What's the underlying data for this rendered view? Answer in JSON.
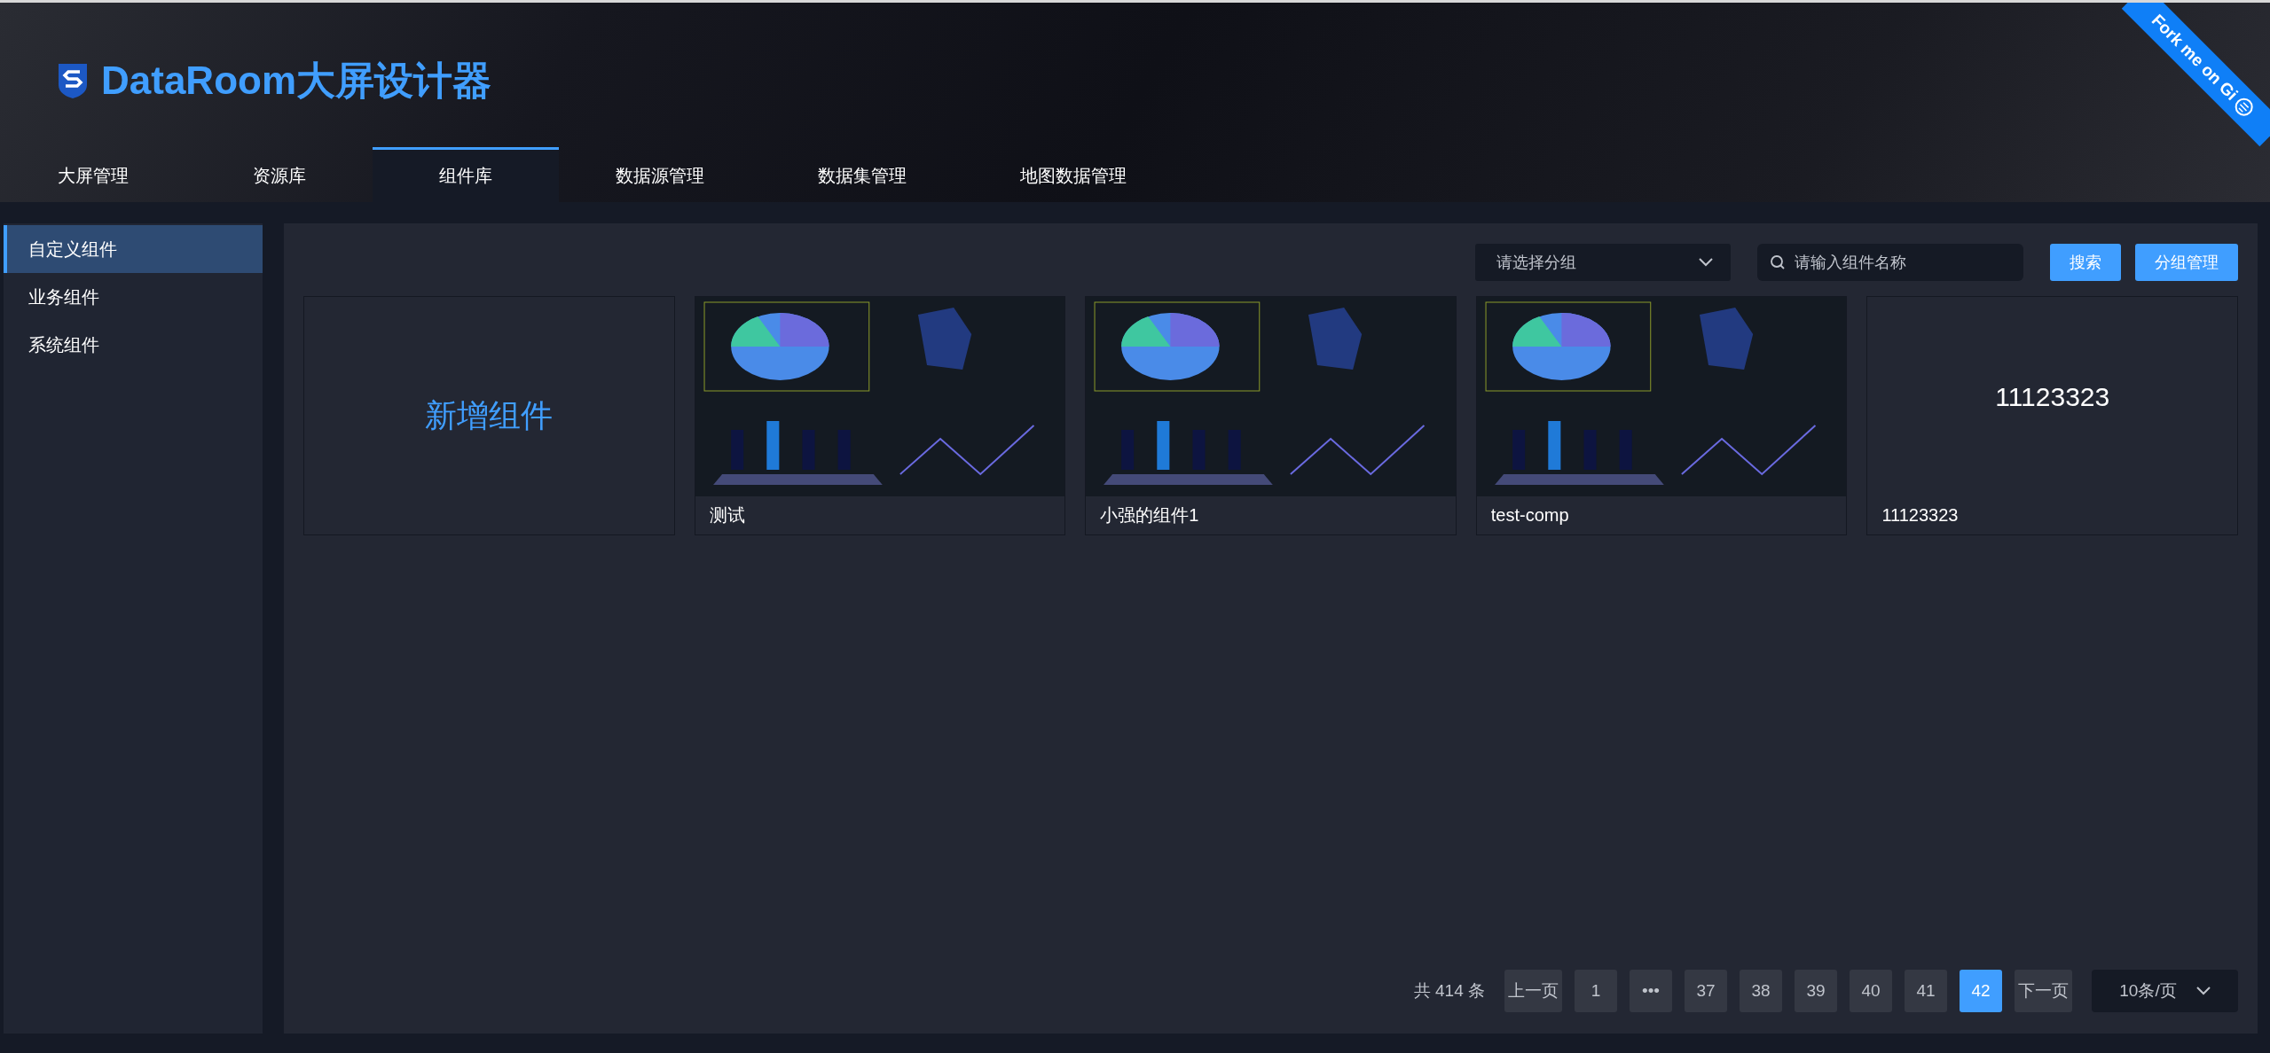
{
  "header": {
    "title": "DataRoom大屏设计器",
    "ribbon": "Fork me on Gi"
  },
  "tabs": [
    {
      "label": "大屏管理",
      "selected": false
    },
    {
      "label": "资源库",
      "selected": false
    },
    {
      "label": "组件库",
      "selected": true
    },
    {
      "label": "数据源管理",
      "selected": false
    },
    {
      "label": "数据集管理",
      "selected": false
    },
    {
      "label": "地图数据管理",
      "selected": false
    }
  ],
  "sidebar": {
    "items": [
      {
        "label": "自定义组件",
        "selected": true
      },
      {
        "label": "业务组件",
        "selected": false
      },
      {
        "label": "系统组件",
        "selected": false
      }
    ]
  },
  "toolbar": {
    "group_select": {
      "placeholder": "请选择分组"
    },
    "search": {
      "placeholder": "请输入组件名称"
    },
    "buttons": [
      "搜索",
      "分组管理"
    ]
  },
  "cards": [
    {
      "kind": "add",
      "label": "新增组件"
    },
    {
      "kind": "preview",
      "name": "测试"
    },
    {
      "kind": "preview",
      "name": "小强的组件1"
    },
    {
      "kind": "preview",
      "name": "test-comp"
    },
    {
      "kind": "text",
      "preview_text": "11123323",
      "name": "11123323"
    }
  ],
  "pagination": {
    "total": "共 414 条",
    "prev": "上一页",
    "next": "下一页",
    "page_size": "10条/页",
    "pages": [
      {
        "label": "1",
        "selected": false
      },
      {
        "label": "•••",
        "selected": false
      },
      {
        "label": "37",
        "selected": false
      },
      {
        "label": "38",
        "selected": false
      },
      {
        "label": "39",
        "selected": false
      },
      {
        "label": "40",
        "selected": false
      },
      {
        "label": "41",
        "selected": false
      },
      {
        "label": "42",
        "selected": true
      }
    ]
  }
}
